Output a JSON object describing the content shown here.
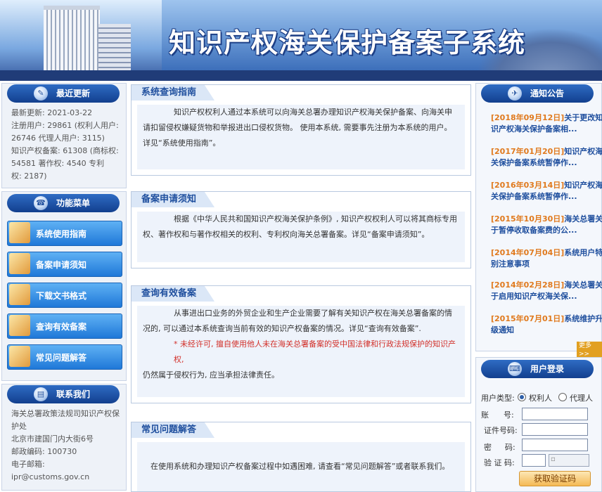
{
  "banner": {
    "title": "知识产权海关保护备案子系统"
  },
  "latest": {
    "heading": "最近更新",
    "lines": [
      "最新更新: 2021-03-22",
      "注册用户: 29861 (权利人用户:",
      "26746  代理人用户: 3115)",
      "知识产权备案: 61308 (商标权:",
      "54581  著作权: 4540  专利",
      "权: 2187)"
    ]
  },
  "menu": {
    "heading": "功能菜单",
    "items": [
      "系统使用指南",
      "备案申请须知",
      "下载文书格式",
      "查询有效备案",
      "常见问题解答"
    ]
  },
  "contact": {
    "heading": "联系我们",
    "lines": [
      "海关总署政策法规司知识产权保",
      "护处",
      "北京市建国门内大街6号",
      "邮政编码: 100730",
      "电子邮箱:",
      "ipr@customs.gov.cn"
    ]
  },
  "sections": {
    "guide": {
      "title": "系统查询指南",
      "text": "知识产权权利人通过本系统可以向海关总署办理知识产权海关保护备案、向海关申请扣留侵权嫌疑货物和举报进出口侵权货物。 使用本系统, 需要事先注册为本系统的用户。详见“系统使用指南”。"
    },
    "apply": {
      "title": "备案申请须知",
      "text": "根据《中华人民共和国知识产权海关保护条例》, 知识产权权利人可以将其商标专用权、著作权和与著作权相关的权利、专利权向海关总署备案。详见“备案申请须知”。"
    },
    "query": {
      "title": "查询有效备案",
      "text": "从事进出口业务的外贸企业和生产企业需要了解有关知识产权在海关总署备案的情况的, 可以通过本系统查询当前有效的知识产权备案的情况。详见“查询有效备案”.",
      "warning": "* 未经许可, 擅自使用他人未在海关总署备案的受中国法律和行政法规保护的知识产权,",
      "warning_tail": "仍然属于侵权行为, 应当承担法律责任。"
    },
    "faq": {
      "title": "常见问题解答",
      "text": "在使用系统和办理知识产权备案过程中如遇困难, 请查看“常见问题解答”或者联系我们。"
    }
  },
  "notice": {
    "heading": "通知公告",
    "items": [
      {
        "date": "[2018年09月12日]",
        "text": "关于更改知识产权海关保护备案相..."
      },
      {
        "date": "[2017年01月20日]",
        "text": "知识产权海关保护备案系统暂停作..."
      },
      {
        "date": "[2016年03月14日]",
        "text": "知识产权海关保护备案系统暂停作..."
      },
      {
        "date": "[2015年10月30日]",
        "text": "海关总署关于暂停收取备案费的公..."
      },
      {
        "date": "[2014年07月04日]",
        "text": "系统用户特别注意事项"
      },
      {
        "date": "[2014年02月28日]",
        "text": "海关总署关于启用知识产权海关保..."
      },
      {
        "date": "[2015年07月01日]",
        "text": "系统维护升级通知"
      }
    ],
    "more": "更多>>"
  },
  "login": {
    "heading": "用户登录",
    "user_type_label": "用户类型:",
    "opt1": "权利人",
    "opt2": "代理人",
    "account_label_1": "账",
    "account_label_2": "号:",
    "cert_label": "证件号码:",
    "pwd_label_1": "密",
    "pwd_label_2": "码:",
    "code_label": "验 证 码:",
    "code_button": "获取验证码"
  }
}
